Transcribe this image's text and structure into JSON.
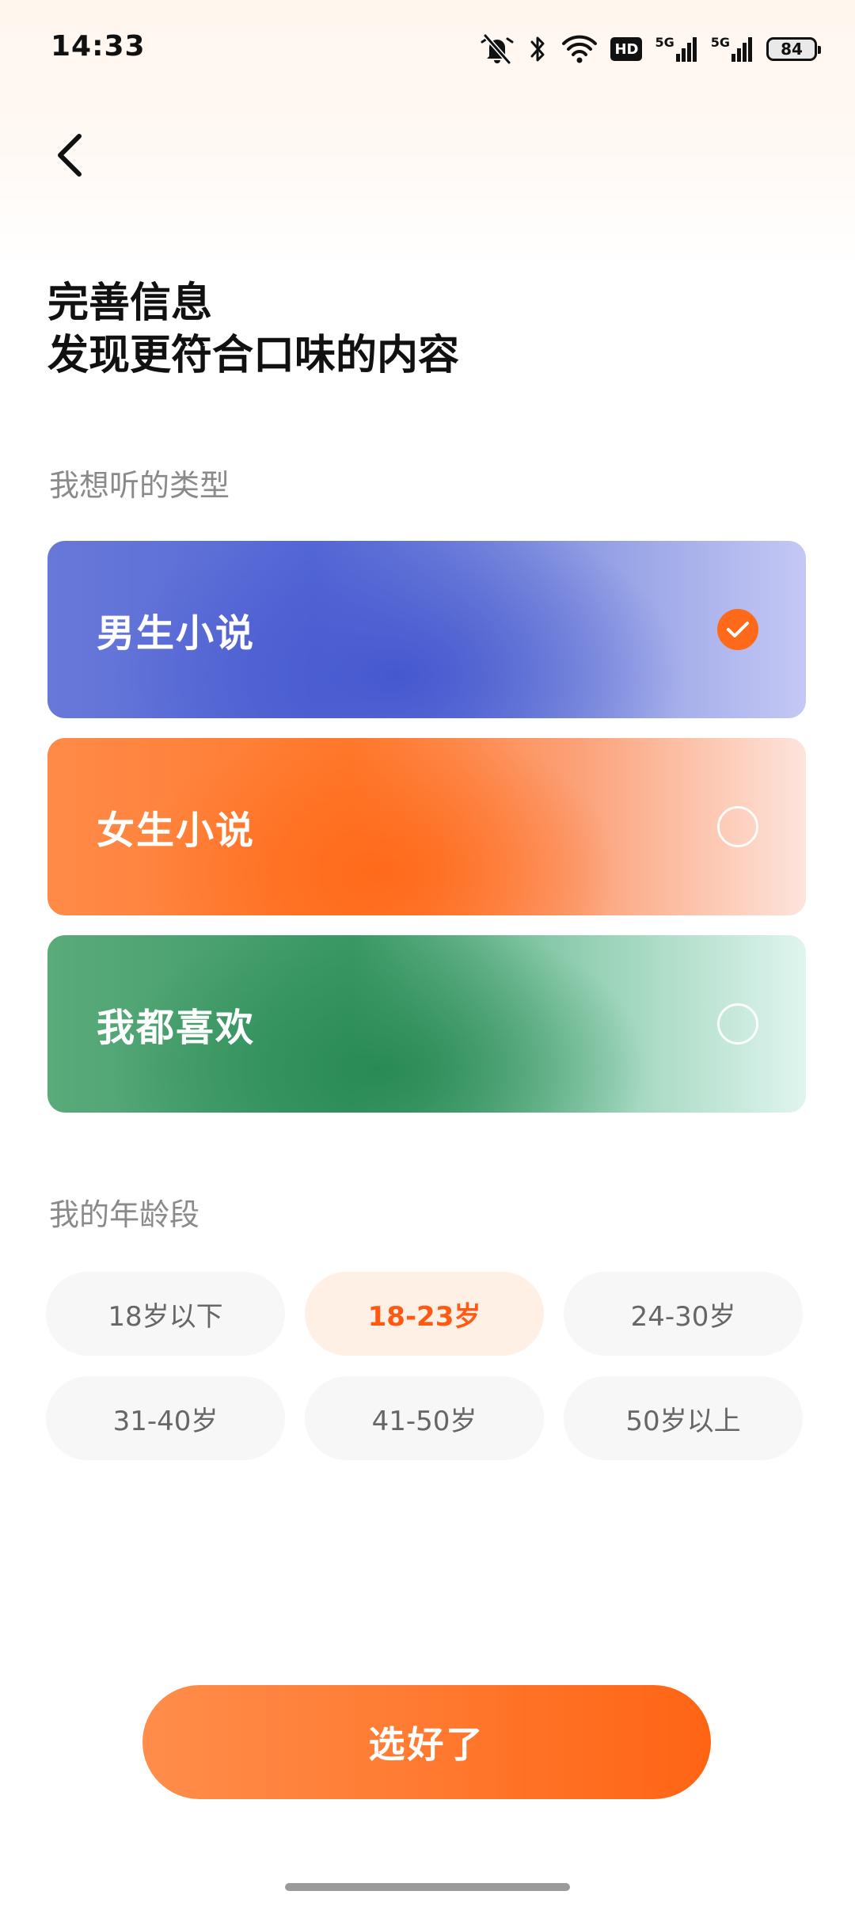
{
  "status_bar": {
    "time": "14:33",
    "battery": "84",
    "hd_label": "HD",
    "net_label_1": "5G",
    "net_label_2": "5G"
  },
  "header": {
    "title_line1": "完善信息",
    "title_line2": "发现更符合口味的内容"
  },
  "genre_section": {
    "label": "我想听的类型",
    "options": [
      {
        "label": "男生小说",
        "selected": true,
        "color": "#5669d6"
      },
      {
        "label": "女生小说",
        "selected": false,
        "color": "#ff7a2e"
      },
      {
        "label": "我都喜欢",
        "selected": false,
        "color": "#3c9a66"
      }
    ]
  },
  "age_section": {
    "label": "我的年龄段",
    "options": [
      {
        "label": "18岁以下",
        "selected": false
      },
      {
        "label": "18-23岁",
        "selected": true
      },
      {
        "label": "24-30岁",
        "selected": false
      },
      {
        "label": "31-40岁",
        "selected": false
      },
      {
        "label": "41-50岁",
        "selected": false
      },
      {
        "label": "50岁以上",
        "selected": false
      }
    ]
  },
  "confirm_label": "选好了",
  "colors": {
    "accent": "#ff6a1a",
    "chip_selected_bg": "#fff0e6",
    "chip_bg": "#f7f7f7"
  }
}
